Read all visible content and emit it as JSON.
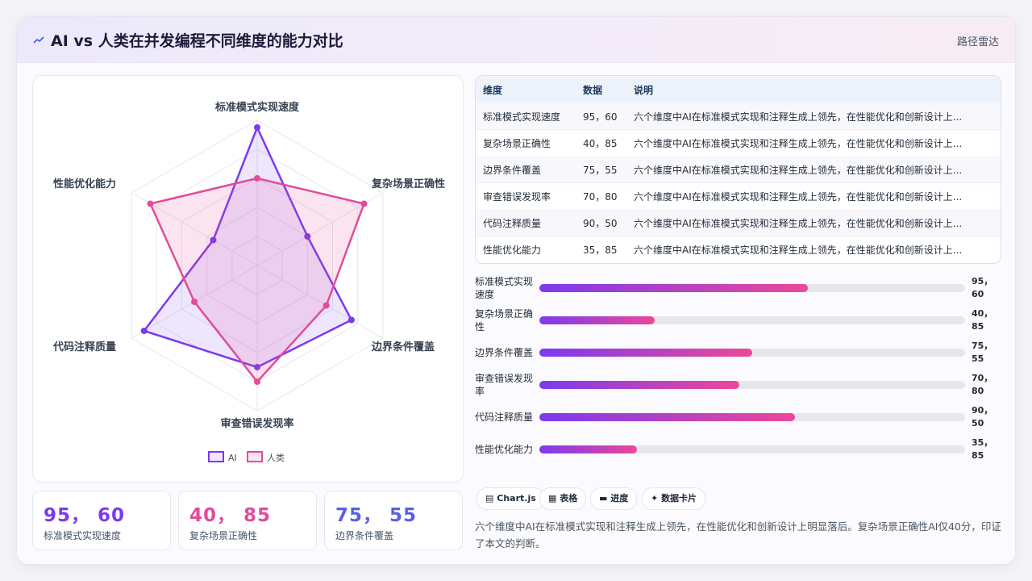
{
  "header": {
    "title": "AI vs 人类在并发编程不同维度的能力对比",
    "route_label": "路径雷达"
  },
  "colors": {
    "ai": "#7c3aed",
    "human": "#e14c9b"
  },
  "chart_data": {
    "type": "radar",
    "categories": [
      "标准模式实现速度",
      "复杂场景正确性",
      "边界条件覆盖",
      "审查错误发现率",
      "代码注释质量",
      "性能优化能力"
    ],
    "series": [
      {
        "name": "AI",
        "values": [
          95,
          40,
          75,
          70,
          90,
          35
        ]
      },
      {
        "name": "人类",
        "values": [
          60,
          85,
          55,
          80,
          50,
          85
        ]
      }
    ],
    "rlim": [
      0,
      100
    ]
  },
  "stats": [
    {
      "value": "95， 60",
      "label": "标准模式实现速度",
      "color": "#7c3aed"
    },
    {
      "value": "40， 85",
      "label": "复杂场景正确性",
      "color": "#e14c9b"
    },
    {
      "value": "75， 55",
      "label": "边界条件覆盖",
      "color": "#5b5ee6"
    }
  ],
  "table": {
    "headers": [
      "维度",
      "数据",
      "说明"
    ],
    "rows": [
      {
        "dim": "标准模式实现速度",
        "data": "95，60",
        "note": "六个维度中AI在标准模式实现和注释生成上领先，在性能优化和创新设计上..."
      },
      {
        "dim": "复杂场景正确性",
        "data": "40，85",
        "note": "六个维度中AI在标准模式实现和注释生成上领先，在性能优化和创新设计上..."
      },
      {
        "dim": "边界条件覆盖",
        "data": "75，55",
        "note": "六个维度中AI在标准模式实现和注释生成上领先，在性能优化和创新设计上..."
      },
      {
        "dim": "审查错误发现率",
        "data": "70，80",
        "note": "六个维度中AI在标准模式实现和注释生成上领先，在性能优化和创新设计上..."
      },
      {
        "dim": "代码注释质量",
        "data": "90，50",
        "note": "六个维度中AI在标准模式实现和注释生成上领先，在性能优化和创新设计上..."
      },
      {
        "dim": "性能优化能力",
        "data": "35，85",
        "note": "六个维度中AI在标准模式实现和注释生成上领先，在性能优化和创新设计上..."
      }
    ]
  },
  "bars": [
    {
      "label_l1": "标准模式实现",
      "label_l2": "速度",
      "v1": "95，",
      "v2": "60",
      "progress": 0.63
    },
    {
      "label_l1": "复杂场景正确",
      "label_l2": "性",
      "v1": "40，",
      "v2": "85",
      "progress": 0.27
    },
    {
      "label_l1": "边界条件覆盖",
      "label_l2": "",
      "v1": "75，",
      "v2": "55",
      "progress": 0.5
    },
    {
      "label_l1": "审查错误发现",
      "label_l2": "率",
      "v1": "70，",
      "v2": "80",
      "progress": 0.47
    },
    {
      "label_l1": "代码注释质量",
      "label_l2": "",
      "v1": "90，",
      "v2": "50",
      "progress": 0.6
    },
    {
      "label_l1": "性能优化能力",
      "label_l2": "",
      "v1": "35，",
      "v2": "85",
      "progress": 0.23
    }
  ],
  "chips": [
    {
      "icon": "▤",
      "label": "Chart.js"
    },
    {
      "icon": "▦",
      "label": "表格"
    },
    {
      "icon": "▬",
      "label": "进度"
    },
    {
      "icon": "✦",
      "label": "数据卡片"
    }
  ],
  "note": "六个维度中AI在标准模式实现和注释生成上领先，在性能优化和创新设计上明显落后。复杂场景正确性AI仅40分，印证了本文的判断。"
}
